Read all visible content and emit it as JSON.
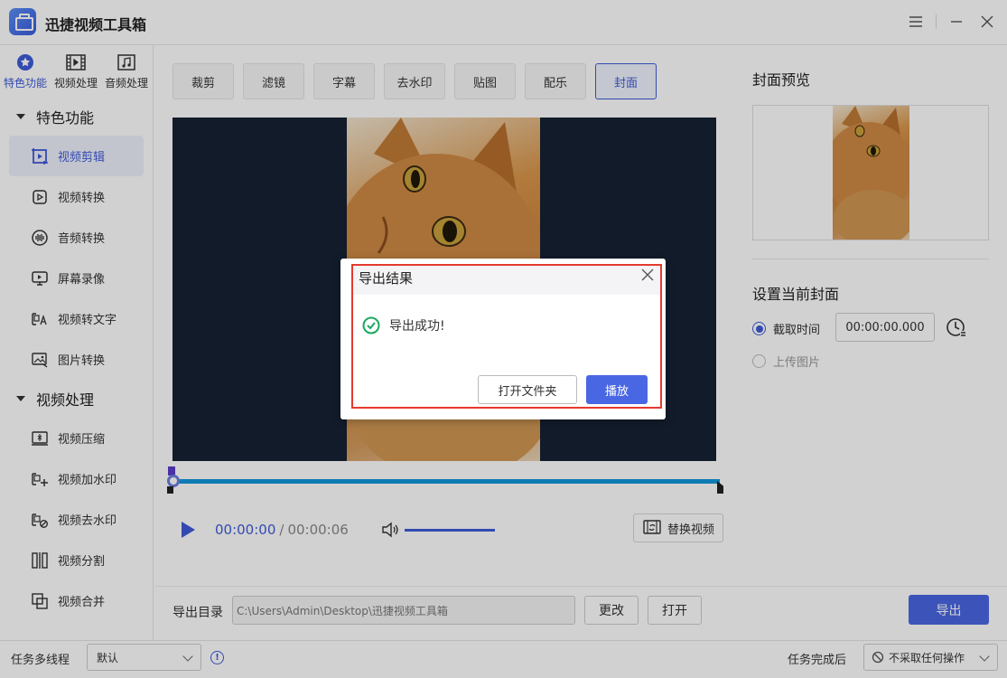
{
  "app": {
    "title": "迅捷视频工具箱"
  },
  "sidebar": {
    "top_tabs": [
      {
        "label": "特色功能",
        "icon": "star-icon",
        "active": true
      },
      {
        "label": "视频处理",
        "icon": "film-icon",
        "active": false
      },
      {
        "label": "音频处理",
        "icon": "music-icon",
        "active": false
      }
    ],
    "groups": [
      {
        "label": "特色功能",
        "items": [
          {
            "label": "视频剪辑",
            "icon": "video-edit-icon",
            "active": true
          },
          {
            "label": "视频转换",
            "icon": "video-convert-icon"
          },
          {
            "label": "音频转换",
            "icon": "audio-convert-icon"
          },
          {
            "label": "屏幕录像",
            "icon": "screen-record-icon"
          },
          {
            "label": "视频转文字",
            "icon": "video-to-text-icon"
          },
          {
            "label": "图片转换",
            "icon": "image-convert-icon"
          }
        ]
      },
      {
        "label": "视频处理",
        "items": [
          {
            "label": "视频压缩",
            "icon": "video-compress-icon"
          },
          {
            "label": "视频加水印",
            "icon": "add-watermark-icon"
          },
          {
            "label": "视频去水印",
            "icon": "remove-watermark-icon"
          },
          {
            "label": "视频分割",
            "icon": "video-split-icon"
          },
          {
            "label": "视频合并",
            "icon": "video-merge-icon"
          }
        ]
      }
    ]
  },
  "tool_tabs": [
    "裁剪",
    "滤镜",
    "字幕",
    "去水印",
    "贴图",
    "配乐",
    "封面"
  ],
  "active_tool_tab": "封面",
  "player": {
    "current_time": "00:00:00",
    "separator": "/",
    "total_time": "00:00:06",
    "replace_label": "替换视频",
    "progress": 0
  },
  "cover": {
    "preview_title": "封面预览",
    "set_title": "设置当前封面",
    "option_capture": "截取时间",
    "capture_time": "00:00:00.000",
    "option_upload": "上传图片"
  },
  "export": {
    "label": "导出目录",
    "path": "C:\\Users\\Admin\\Desktop\\迅捷视频工具箱",
    "change_label": "更改",
    "open_label": "打开",
    "export_label": "导出"
  },
  "statusbar": {
    "threads_label": "任务多线程",
    "threads_value": "默认",
    "after_label": "任务完成后",
    "after_value": "不采取任何操作"
  },
  "dialog": {
    "title": "导出结果",
    "message": "导出成功!",
    "open_folder_label": "打开文件夹",
    "play_label": "播放"
  },
  "colors": {
    "accent": "#4a67e3",
    "highlight_border": "#e53a2f",
    "video_bg": "#162134",
    "success": "#1aa760"
  }
}
